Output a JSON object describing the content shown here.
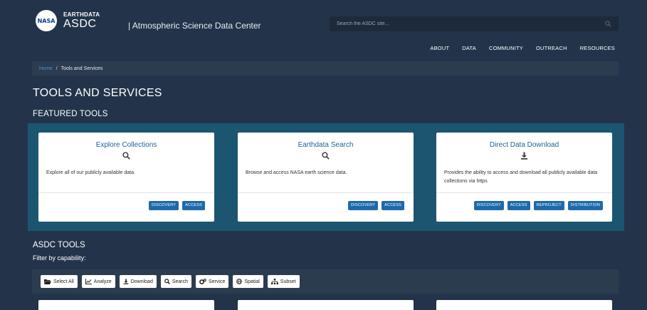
{
  "header": {
    "logo_text": "NASA",
    "brand_top": "EARTHDATA",
    "brand_main": "ASDC",
    "brand_sub": "| Atmospheric Science Data Center",
    "search_placeholder": "Search the ASDC site..."
  },
  "nav": [
    {
      "label": "ABOUT"
    },
    {
      "label": "DATA"
    },
    {
      "label": "COMMUNITY"
    },
    {
      "label": "OUTREACH"
    },
    {
      "label": "RESOURCES"
    }
  ],
  "breadcrumb": {
    "home": "Home",
    "separator": "/",
    "current": "Tools and Services"
  },
  "page_title": "TOOLS AND SERVICES",
  "featured": {
    "title": "FEATURED TOOLS",
    "cards": [
      {
        "title": "Explore Collections",
        "icon": "search-icon",
        "description": "Explore all of our publicly available data.",
        "tags": [
          "DISCOVERY",
          "ACCESS"
        ]
      },
      {
        "title": "Earthdata Search",
        "icon": "search-icon",
        "description": "Browse and access NASA earth science data.",
        "tags": [
          "DISCOVERY",
          "ACCESS"
        ]
      },
      {
        "title": "Direct Data Download",
        "icon": "download-icon",
        "description": "Provides the ability to access and download all publicly available data collections via https",
        "tags": [
          "DISCOVERY",
          "ACCESS",
          "REPROJECT",
          "DISTRIBUTION"
        ]
      }
    ]
  },
  "asdc_tools": {
    "title": "ASDC TOOLS",
    "filter_label": "Filter by capability:",
    "filters": [
      {
        "label": "Select All",
        "icon": "folder-open-icon"
      },
      {
        "label": "Analyze",
        "icon": "line-chart-icon"
      },
      {
        "label": "Download",
        "icon": "download-icon"
      },
      {
        "label": "Search",
        "icon": "search-icon"
      },
      {
        "label": "Service",
        "icon": "cogs-icon"
      },
      {
        "label": "Spatial",
        "icon": "globe-icon"
      },
      {
        "label": "Subset",
        "icon": "sitemap-icon"
      }
    ]
  },
  "colors": {
    "background": "#23344a",
    "featured_band": "#1c5570",
    "tag": "#1d6aab",
    "link": "#4d8fd4",
    "card_title": "#1f5f9d"
  }
}
